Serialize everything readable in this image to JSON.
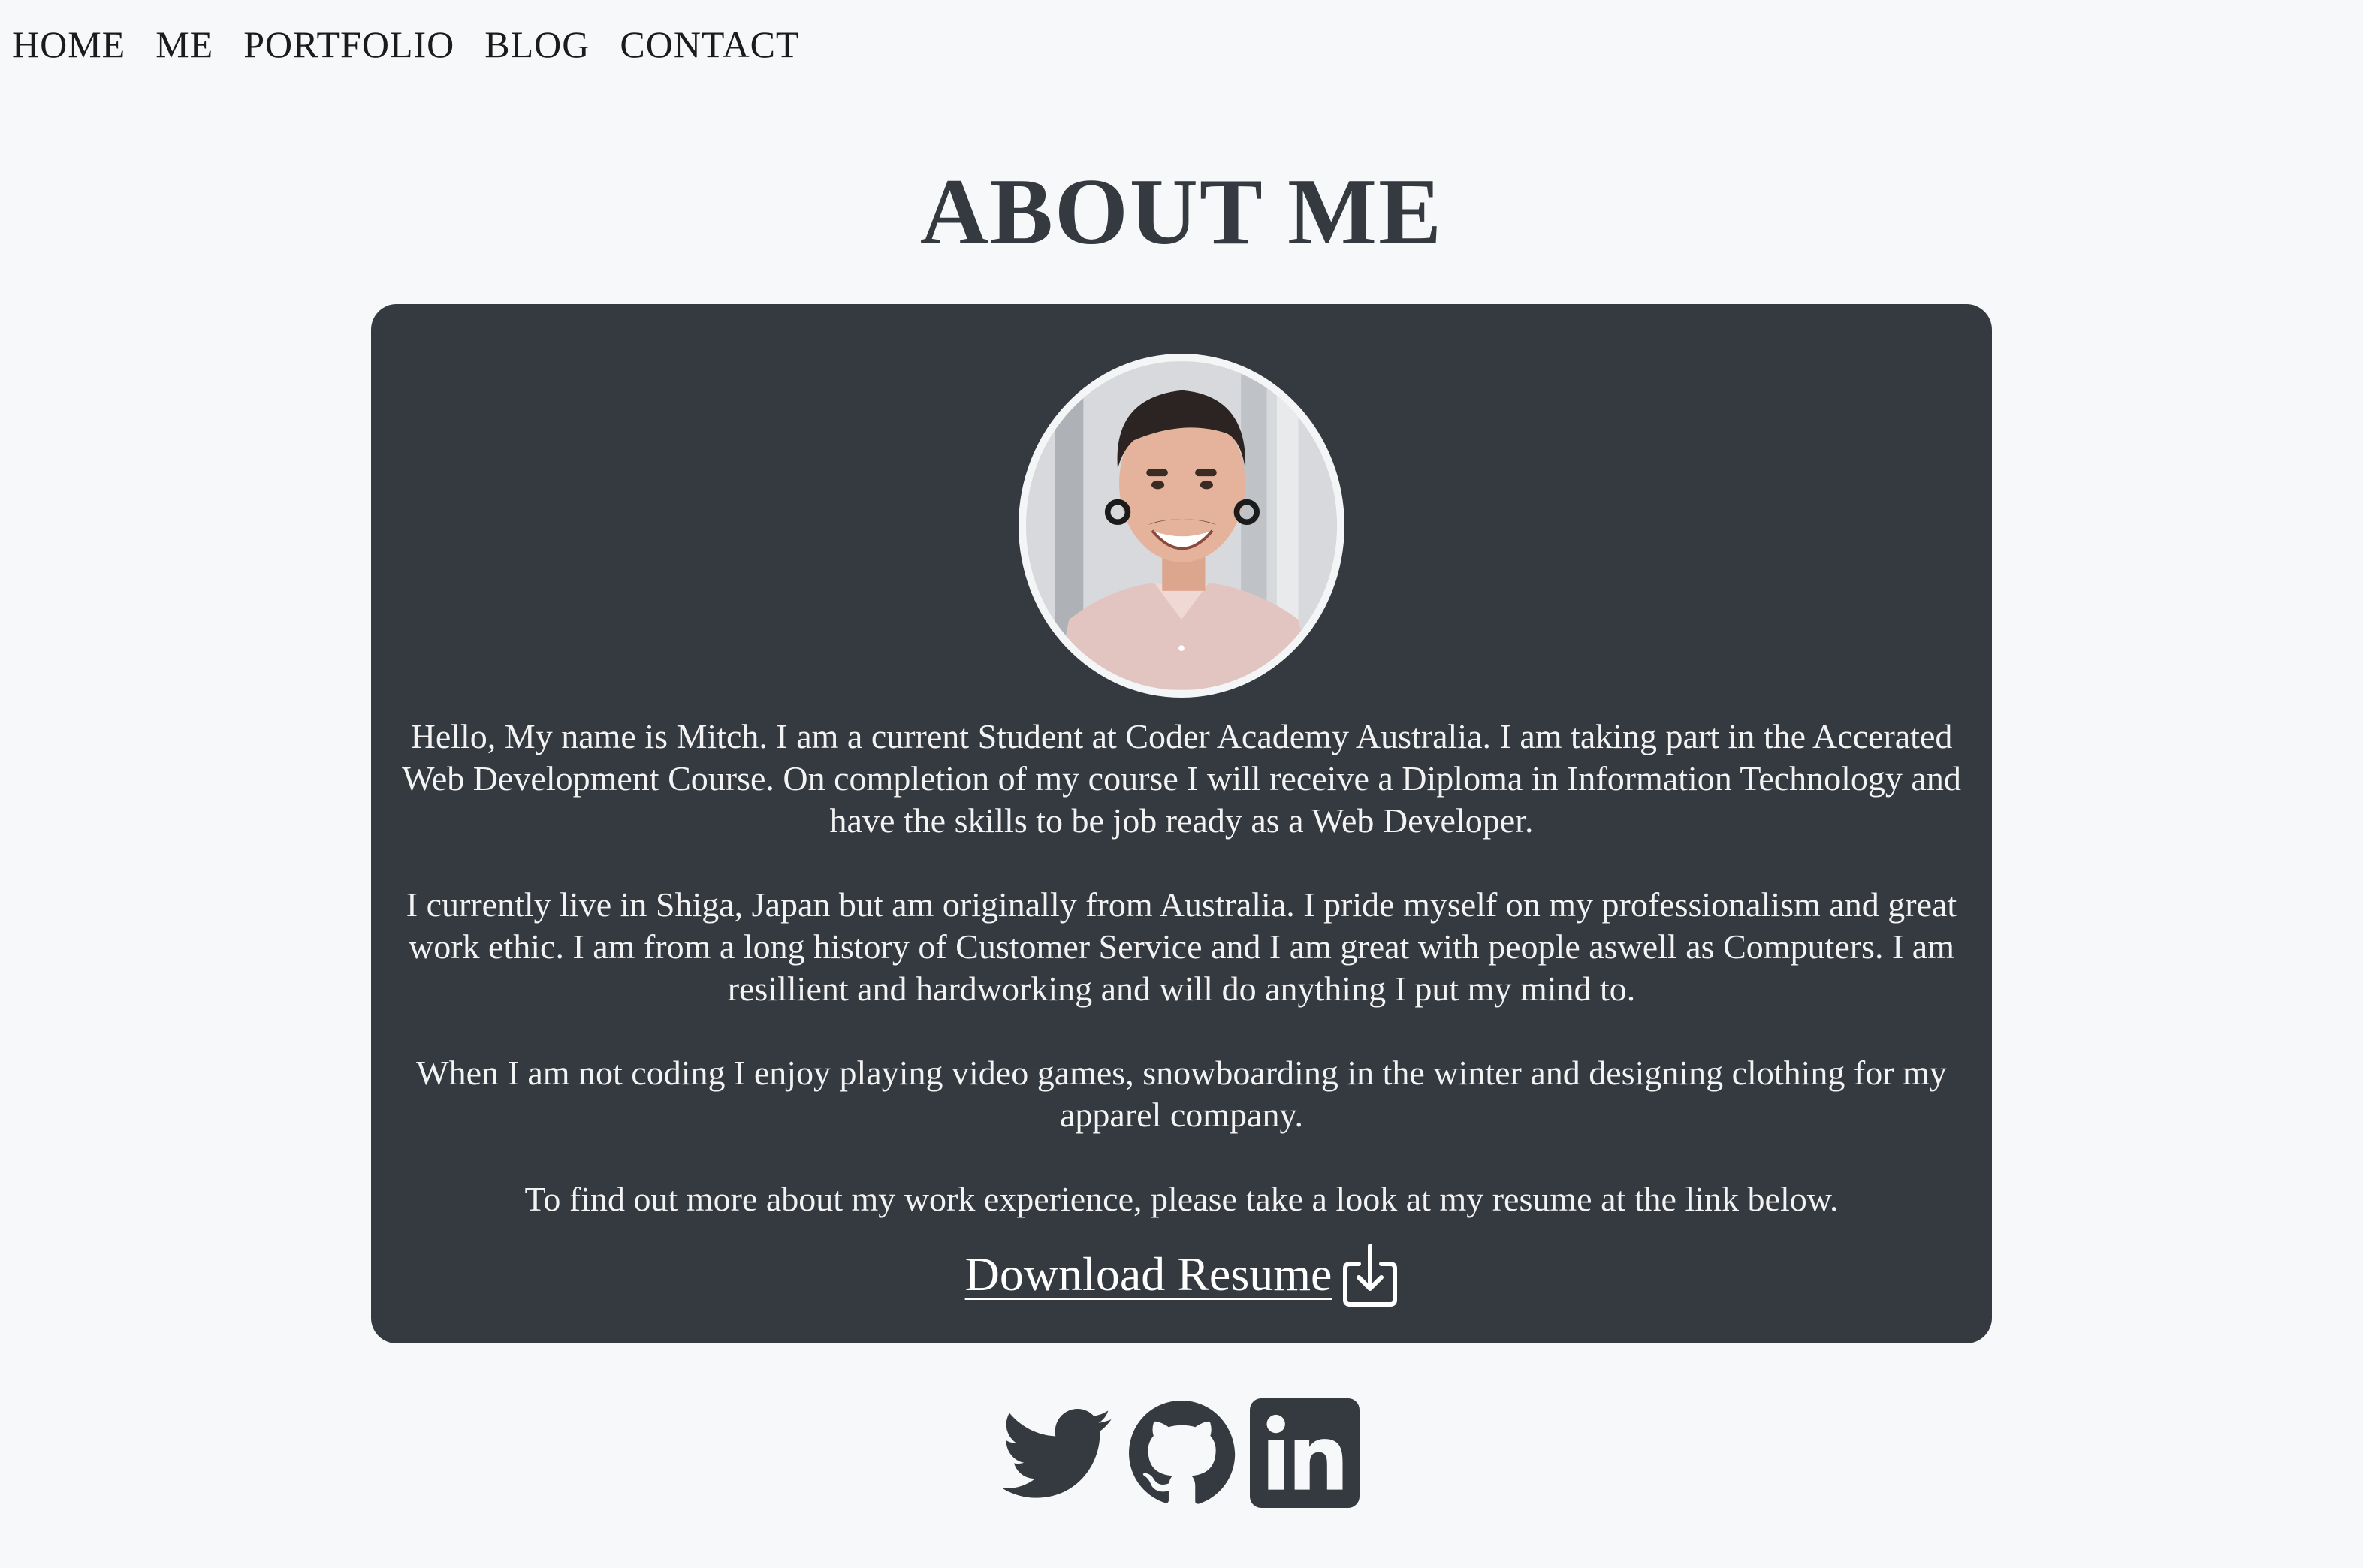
{
  "nav": {
    "items": [
      {
        "label": "HOME"
      },
      {
        "label": "ME"
      },
      {
        "label": "PORTFOLIO"
      },
      {
        "label": "BLOG"
      },
      {
        "label": "CONTACT"
      }
    ]
  },
  "page": {
    "title": "ABOUT ME"
  },
  "bio": {
    "paragraphs": [
      "Hello, My name is Mitch. I am a current Student at Coder Academy Australia. I am taking part in the Accerated Web Development Course. On completion of my course I will receive a Diploma in Information Technology and have the skills to be job ready as a Web Developer.",
      "I currently live in Shiga, Japan but am originally from Australia. I pride myself on my professionalism and great work ethic. I am from a long history of Customer Service and I am great with people aswell as Computers. I am resillient and hardworking and will do anything I put my mind to.",
      "When I am not coding I enjoy playing video games, snowboarding in the winter and designing clothing for my apparel company.",
      "To find out more about my work experience, please take a look at my resume at the link below."
    ]
  },
  "download": {
    "label": "Download Resume",
    "icon": "download-icon"
  },
  "socials": [
    {
      "icon": "twitter-icon"
    },
    {
      "icon": "github-icon"
    },
    {
      "icon": "linkedin-icon"
    }
  ],
  "colors": {
    "background": "#f7f8fa",
    "card": "#353a40",
    "title": "#353a40",
    "card_text": "#f3f3f3"
  }
}
